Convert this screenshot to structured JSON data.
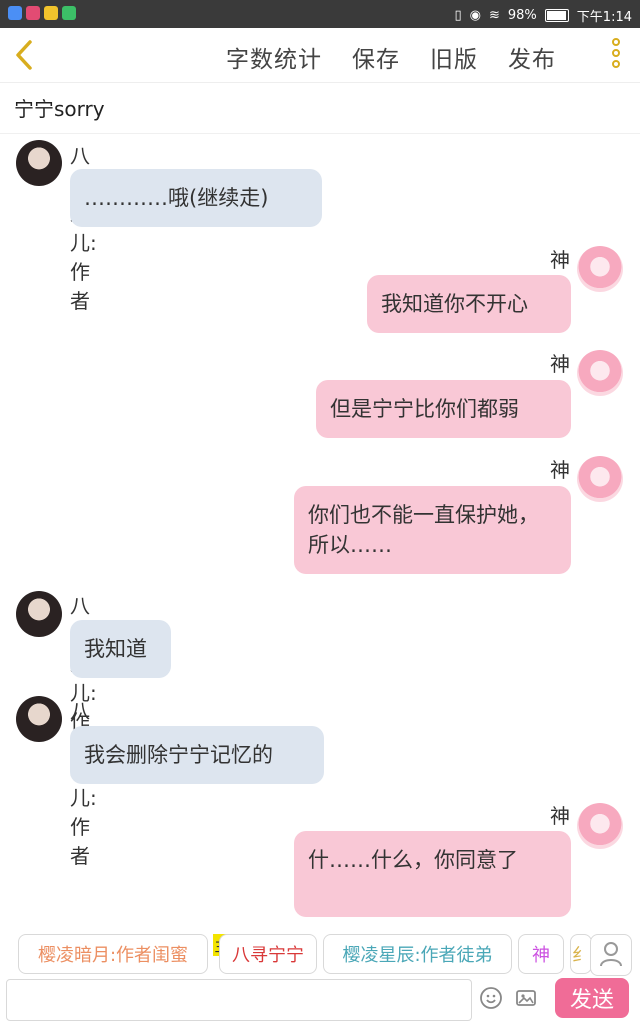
{
  "status_bar": {
    "battery": "98%",
    "time": "下午1:14"
  },
  "top_bar": {
    "back_icon": "chevron-left-icon",
    "actions": [
      "字数统计",
      "保存",
      "旧版",
      "发布"
    ],
    "more_icon": "kebab-menu-icon"
  },
  "story": {
    "title": "宁宁sorry"
  },
  "messages": [
    {
      "sender": "八寻绘儿:作者",
      "text": "…………哦(继续走)",
      "side": "left"
    },
    {
      "sender": "神",
      "text": "我知道你不开心",
      "side": "right"
    },
    {
      "sender": "神",
      "text": "但是宁宁比你们都弱",
      "side": "right"
    },
    {
      "sender": "神",
      "text": "你们也不能一直保护她，所以……",
      "side": "right"
    },
    {
      "sender": "八寻绘儿:作者",
      "text": "我知道",
      "side": "left"
    },
    {
      "sender": "八寻绘儿:作者",
      "text": "我会删除宁宁记忆的",
      "side": "left"
    },
    {
      "sender": "神",
      "text": "什……什么，你同意了",
      "side": "right"
    }
  ],
  "character_chips": [
    {
      "label": "樱凌暗月:作者闺蜜"
    },
    {
      "label": "八寻宁宁"
    },
    {
      "label": "樱凌星辰:作者徒弟"
    },
    {
      "label": "神"
    },
    {
      "label": "纟"
    }
  ],
  "host_tag": "主",
  "composer": {
    "send_label": "发送"
  },
  "colors": {
    "accent": "#f06c97",
    "right_bubble": "#f9c8d6",
    "left_bubble": "#dde5ef"
  }
}
